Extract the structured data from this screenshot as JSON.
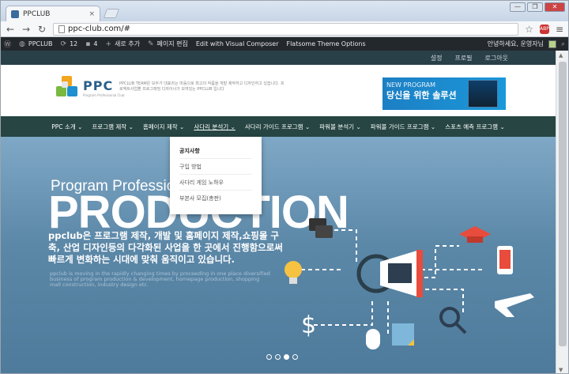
{
  "browser": {
    "tab_title": "PPCLUB",
    "tab_close": "×",
    "url_text": "ppc-club.com/#",
    "window_controls": [
      "—",
      "❐",
      "✕"
    ]
  },
  "admin_bar": {
    "site_name": "PPCLUB",
    "updates_count": "12",
    "comments_count": "4",
    "new_item": "새로 추가",
    "edit_page": "페이지 편집",
    "visual_composer": "Edit with Visual Composer",
    "theme_options": "Flatsome Theme Options",
    "greeting": "안녕하세요, 운영자님"
  },
  "top_links": [
    "설정",
    "프로필",
    "로그아웃"
  ],
  "header": {
    "logo_text": "PPC",
    "logo_sub": "Program Professional Club",
    "tagline": "PPCLUB TEAM은 모두가 대표라는 마음으로 최고의 작품을 개발 제작하고 디자인하고 있습니다. 프로젝트사업뿐 프로그래밍 디자이너가 모여있는 PPCLUB 입니다",
    "banner_line1": "NEW PROGRAM",
    "banner_line2": "당신을 위한 솔루션"
  },
  "nav": [
    "PPC 소개",
    "프로그램 제작",
    "홈페이지 제작",
    "사다리 분석기",
    "사다리 가이드 프로그램",
    "파워볼 분석기",
    "파워볼 가이드 프로그램",
    "스포츠 예측 프로그램"
  ],
  "nav_active_index": 3,
  "dropdown": [
    "공지사항",
    "구입 방법",
    "사다리 게임 노하우",
    "부본사 모집(총판)"
  ],
  "hero": {
    "subtitle": "Program Professional Club",
    "title": "PRODUCTION",
    "korean_text": "ppclub은 프로그램 제작, 개발 및 홈페이지 제작,쇼핑몰 구축, 산업 디자인등의 다각화된 사업을 한 곳에서 진행함으로써 빠르게 변화하는 시대에 맞춰 움직이고 있습니다.",
    "english_text": "ppclub is moving in the rapidly changing times by proceeding in one place diversified business of program production & development, homepage production, shopping mall construction, industry design etc.",
    "slider_dots": 4,
    "active_dot": 2
  },
  "colors": {
    "admin_bar": "#23282d",
    "top_bar": "#2a4049",
    "nav_bg": "#264543",
    "hero_top": "#7fa8c6",
    "hero_bottom": "#4e7a9b",
    "banner": "#1a98d9"
  }
}
